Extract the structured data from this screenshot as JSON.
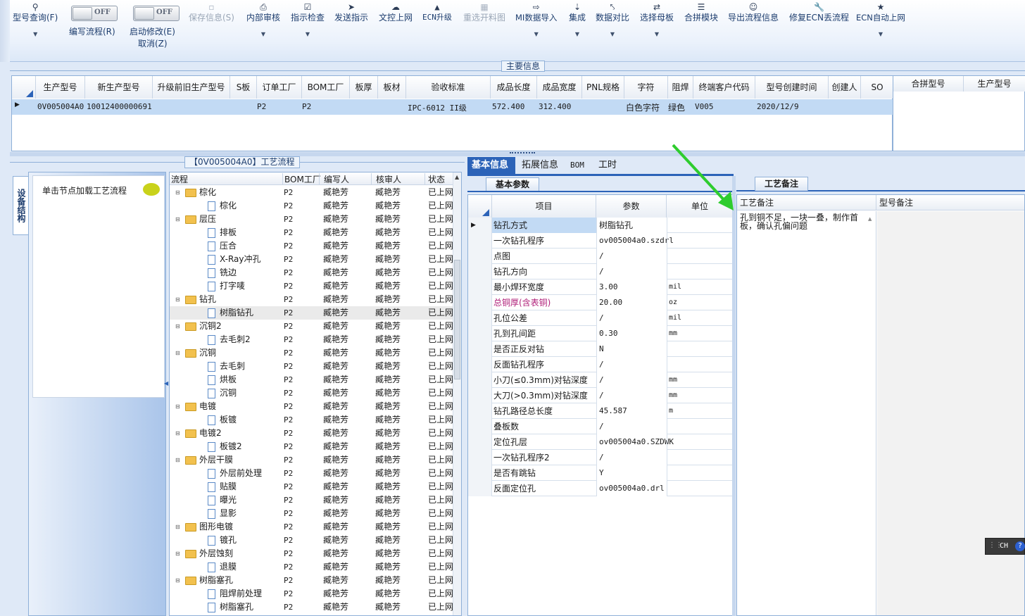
{
  "toolbar": {
    "items": [
      {
        "label": "型号查询(F)",
        "icon": "search-icon"
      },
      {
        "label": "保存信息(S)",
        "icon": "save-icon"
      },
      {
        "label": "内部审核",
        "icon": "print-icon"
      },
      {
        "label": "指示检查",
        "icon": "checkbox-icon"
      },
      {
        "label": "发送指示",
        "icon": "send-icon"
      },
      {
        "label": "文控上网",
        "icon": "cloud-upload-icon"
      },
      {
        "label": "ECN升级",
        "icon": "ecn-icon"
      },
      {
        "label": "重选开料图",
        "icon": "image-icon"
      },
      {
        "label": "MI数据导入",
        "icon": "import-icon"
      },
      {
        "label": "集成",
        "icon": "download-icon"
      },
      {
        "label": "数据对比",
        "icon": "compare-icon"
      },
      {
        "label": "选择母板",
        "icon": "shuffle-icon"
      },
      {
        "label": "合拼模块",
        "icon": "list-icon"
      },
      {
        "label": "导出流程信息",
        "icon": "smile-icon"
      },
      {
        "label": "修复ECN丢流程",
        "icon": "wrench-icon"
      },
      {
        "label": "ECN自动上网",
        "icon": "star-icon"
      }
    ],
    "toggle1": {
      "label": "编写流程(R)",
      "state": "OFF"
    },
    "toggle2": {
      "label": "启动修改(E)",
      "state": "OFF",
      "sub": "取消(Z)"
    }
  },
  "main_info": {
    "caption": "主要信息",
    "headers": [
      "生产型号",
      "新生产型号",
      "升级前旧生产型号",
      "S板",
      "订单工厂",
      "BOM工厂",
      "板厚",
      "板材",
      "验收标准",
      "成品长度",
      "成品宽度",
      "PNL规格",
      "字符",
      "阻焊",
      "终端客户代码",
      "型号创建时间",
      "创建人",
      "SO"
    ],
    "row": [
      "0V005004A0",
      "10012400000691",
      "",
      "",
      "P2",
      "P2",
      "",
      "",
      "IPC-6012 II级",
      "572.400",
      "312.400",
      "",
      "白色字符",
      "绿色",
      "V005",
      "2020/12/9",
      "",
      ""
    ],
    "merge_headers": [
      "合拼型号",
      "生产型号"
    ]
  },
  "flow": {
    "caption": "【0V005004A0】工艺流程",
    "side_tab": "设备结构",
    "click_hint": "单击节点加载工艺流程",
    "headers": [
      "流程",
      "BOM工厂",
      "编写人",
      "核审人",
      "状态"
    ],
    "rows": [
      {
        "name": "棕化",
        "lvl": 0,
        "bom": "P2",
        "writer": "臧艳芳",
        "checker": "臧艳芳",
        "status": "已上网"
      },
      {
        "name": "棕化",
        "lvl": 1,
        "bom": "P2",
        "writer": "臧艳芳",
        "checker": "臧艳芳",
        "status": "已上网"
      },
      {
        "name": "层压",
        "lvl": 0,
        "bom": "P2",
        "writer": "臧艳芳",
        "checker": "臧艳芳",
        "status": "已上网"
      },
      {
        "name": "排板",
        "lvl": 1,
        "bom": "P2",
        "writer": "臧艳芳",
        "checker": "臧艳芳",
        "status": "已上网"
      },
      {
        "name": "压合",
        "lvl": 1,
        "bom": "P2",
        "writer": "臧艳芳",
        "checker": "臧艳芳",
        "status": "已上网"
      },
      {
        "name": "X-Ray冲孔",
        "lvl": 1,
        "bom": "P2",
        "writer": "臧艳芳",
        "checker": "臧艳芳",
        "status": "已上网"
      },
      {
        "name": "铣边",
        "lvl": 1,
        "bom": "P2",
        "writer": "臧艳芳",
        "checker": "臧艳芳",
        "status": "已上网"
      },
      {
        "name": "打字唛",
        "lvl": 1,
        "bom": "P2",
        "writer": "臧艳芳",
        "checker": "臧艳芳",
        "status": "已上网"
      },
      {
        "name": "钻孔",
        "lvl": 0,
        "bom": "P2",
        "writer": "臧艳芳",
        "checker": "臧艳芳",
        "status": "已上网"
      },
      {
        "name": "树脂钻孔",
        "lvl": 1,
        "bom": "P2",
        "writer": "臧艳芳",
        "checker": "臧艳芳",
        "status": "已上网",
        "selected": true
      },
      {
        "name": "沉铜2",
        "lvl": 0,
        "bom": "P2",
        "writer": "臧艳芳",
        "checker": "臧艳芳",
        "status": "已上网"
      },
      {
        "name": "去毛刺2",
        "lvl": 1,
        "bom": "P2",
        "writer": "臧艳芳",
        "checker": "臧艳芳",
        "status": "已上网"
      },
      {
        "name": "沉铜",
        "lvl": 0,
        "bom": "P2",
        "writer": "臧艳芳",
        "checker": "臧艳芳",
        "status": "已上网"
      },
      {
        "name": "去毛刺",
        "lvl": 1,
        "bom": "P2",
        "writer": "臧艳芳",
        "checker": "臧艳芳",
        "status": "已上网"
      },
      {
        "name": "烘板",
        "lvl": 1,
        "bom": "P2",
        "writer": "臧艳芳",
        "checker": "臧艳芳",
        "status": "已上网"
      },
      {
        "name": "沉铜",
        "lvl": 1,
        "bom": "P2",
        "writer": "臧艳芳",
        "checker": "臧艳芳",
        "status": "已上网"
      },
      {
        "name": "电镀",
        "lvl": 0,
        "bom": "P2",
        "writer": "臧艳芳",
        "checker": "臧艳芳",
        "status": "已上网"
      },
      {
        "name": "板镀",
        "lvl": 1,
        "bom": "P2",
        "writer": "臧艳芳",
        "checker": "臧艳芳",
        "status": "已上网"
      },
      {
        "name": "电镀2",
        "lvl": 0,
        "bom": "P2",
        "writer": "臧艳芳",
        "checker": "臧艳芳",
        "status": "已上网"
      },
      {
        "name": "板镀2",
        "lvl": 1,
        "bom": "P2",
        "writer": "臧艳芳",
        "checker": "臧艳芳",
        "status": "已上网"
      },
      {
        "name": "外层干膜",
        "lvl": 0,
        "bom": "P2",
        "writer": "臧艳芳",
        "checker": "臧艳芳",
        "status": "已上网"
      },
      {
        "name": "外层前处理",
        "lvl": 1,
        "bom": "P2",
        "writer": "臧艳芳",
        "checker": "臧艳芳",
        "status": "已上网"
      },
      {
        "name": "贴膜",
        "lvl": 1,
        "bom": "P2",
        "writer": "臧艳芳",
        "checker": "臧艳芳",
        "status": "已上网"
      },
      {
        "name": "曝光",
        "lvl": 1,
        "bom": "P2",
        "writer": "臧艳芳",
        "checker": "臧艳芳",
        "status": "已上网"
      },
      {
        "name": "显影",
        "lvl": 1,
        "bom": "P2",
        "writer": "臧艳芳",
        "checker": "臧艳芳",
        "status": "已上网"
      },
      {
        "name": "图形电镀",
        "lvl": 0,
        "bom": "P2",
        "writer": "臧艳芳",
        "checker": "臧艳芳",
        "status": "已上网"
      },
      {
        "name": "镀孔",
        "lvl": 1,
        "bom": "P2",
        "writer": "臧艳芳",
        "checker": "臧艳芳",
        "status": "已上网"
      },
      {
        "name": "外层蚀刻",
        "lvl": 0,
        "bom": "P2",
        "writer": "臧艳芳",
        "checker": "臧艳芳",
        "status": "已上网"
      },
      {
        "name": "退膜",
        "lvl": 1,
        "bom": "P2",
        "writer": "臧艳芳",
        "checker": "臧艳芳",
        "status": "已上网"
      },
      {
        "name": "树脂塞孔",
        "lvl": 0,
        "bom": "P2",
        "writer": "臧艳芳",
        "checker": "臧艳芳",
        "status": "已上网"
      },
      {
        "name": "阻焊前处理",
        "lvl": 1,
        "bom": "P2",
        "writer": "臧艳芳",
        "checker": "臧艳芳",
        "status": "已上网"
      },
      {
        "name": "树脂塞孔",
        "lvl": 1,
        "bom": "P2",
        "writer": "臧艳芳",
        "checker": "臧艳芳",
        "status": "已上网"
      }
    ]
  },
  "detail": {
    "tabs": [
      "基本信息",
      "拓展信息",
      "BOM",
      "工时"
    ],
    "subtab": "基本参数",
    "headers": [
      "项目",
      "参数",
      "单位"
    ],
    "params": [
      {
        "k": "钻孔方式",
        "v": "树脂钻孔",
        "u": ""
      },
      {
        "k": "一次钻孔程序",
        "v": "ov005004a0.szdrl",
        "u": ""
      },
      {
        "k": "点图",
        "v": "/",
        "u": ""
      },
      {
        "k": "钻孔方向",
        "v": "/",
        "u": ""
      },
      {
        "k": "最小焊环宽度",
        "v": "3.00",
        "u": "mil"
      },
      {
        "k": "总铜厚(含表铜)",
        "v": "20.00",
        "u": "oz",
        "highlight": true
      },
      {
        "k": "孔位公差",
        "v": "/",
        "u": "mil"
      },
      {
        "k": "孔到孔间距",
        "v": "0.30",
        "u": "mm"
      },
      {
        "k": "是否正反对钻",
        "v": "N",
        "u": ""
      },
      {
        "k": "反面钻孔程序",
        "v": "/",
        "u": ""
      },
      {
        "k": "小刀(≤0.3mm)对钻深度",
        "v": "/",
        "u": "mm"
      },
      {
        "k": "大刀(>0.3mm)对钻深度",
        "v": "/",
        "u": "mm"
      },
      {
        "k": "钻孔路径总长度",
        "v": "45.587",
        "u": "m"
      },
      {
        "k": "叠板数",
        "v": "/",
        "u": ""
      },
      {
        "k": "定位孔层",
        "v": "ov005004a0.SZDWK",
        "u": ""
      },
      {
        "k": "一次钻孔程序2",
        "v": "/",
        "u": ""
      },
      {
        "k": "是否有跳钻",
        "v": "Y",
        "u": ""
      },
      {
        "k": "反面定位孔",
        "v": "ov005004a0.drl",
        "u": ""
      }
    ]
  },
  "notes": {
    "tab": "工艺备注",
    "process_note_header": "工艺备注",
    "model_note_header": "型号备注",
    "process_note": "孔到铜不足，一块一叠，制作首板，确认孔偏问题"
  },
  "ime": {
    "label": "CH"
  },
  "colors": {
    "selection": "#c2daf4",
    "accent_blue": "#2c63b8",
    "highlight_text": "#b0207a",
    "arrow": "#2ecc2e"
  }
}
